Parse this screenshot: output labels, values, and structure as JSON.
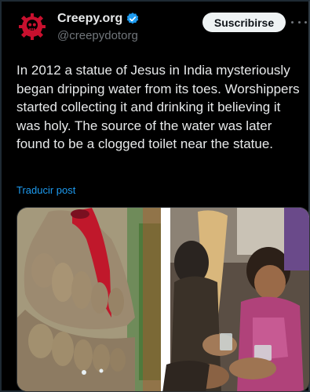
{
  "account": {
    "name": "Creepy.org",
    "handle": "@creepydotorg",
    "verified": true,
    "avatar_icon": "skull-gear-icon",
    "avatar_color": "#c8102e"
  },
  "actions": {
    "subscribe_label": "Suscribirse",
    "more_icon": "more-options-icon"
  },
  "post": {
    "text": "In 2012 a statue of Jesus in India mysteriously began dripping water from its toes. Worshippers started collecting it and drinking it believing it was holy. The source of the water was later found to be a clogged toilet near the statue.",
    "translate_label": "Traducir post"
  },
  "media": {
    "images": [
      {
        "name": "statue-feet-photo"
      },
      {
        "name": "worshippers-collecting-water-photo"
      }
    ]
  },
  "colors": {
    "background": "#000000",
    "text": "#e7e9ea",
    "secondary_text": "#71767b",
    "link": "#1d9bf0",
    "verified_badge": "#1d9bf0"
  }
}
